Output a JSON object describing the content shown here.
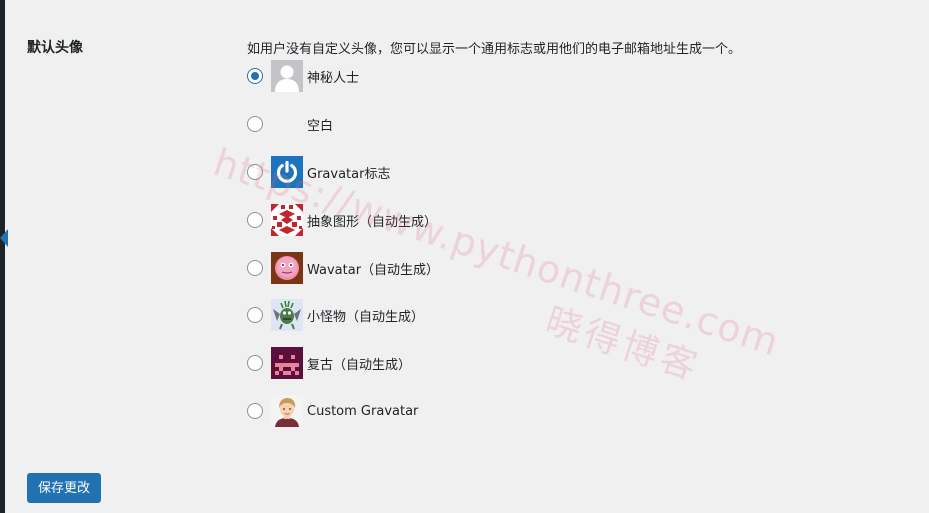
{
  "settings": {
    "row_label": "默认头像",
    "description": "如用户没有自定义头像，您可以显示一个通用标志或用他们的电子邮箱地址生成一个。",
    "options": [
      {
        "label": "神秘人士",
        "checked": true,
        "icon": "mystery-person-avatar"
      },
      {
        "label": "空白",
        "checked": false,
        "icon": "blank-avatar"
      },
      {
        "label": "Gravatar标志",
        "checked": false,
        "icon": "gravatar-logo-avatar"
      },
      {
        "label": "抽象图形（自动生成）",
        "checked": false,
        "icon": "identicon-avatar"
      },
      {
        "label": "Wavatar（自动生成）",
        "checked": false,
        "icon": "wavatar-avatar"
      },
      {
        "label": "小怪物（自动生成）",
        "checked": false,
        "icon": "monsterid-avatar"
      },
      {
        "label": "复古（自动生成）",
        "checked": false,
        "icon": "retro-avatar"
      },
      {
        "label": "Custom Gravatar",
        "checked": false,
        "icon": "custom-gravatar-avatar"
      }
    ],
    "save_label": "保存更改"
  },
  "watermark": {
    "url": "https://www.pythonthree.com",
    "name": "晓得博客"
  },
  "colors": {
    "accent": "#2271b1",
    "background": "#f0f0f1",
    "text": "#1d2327"
  }
}
